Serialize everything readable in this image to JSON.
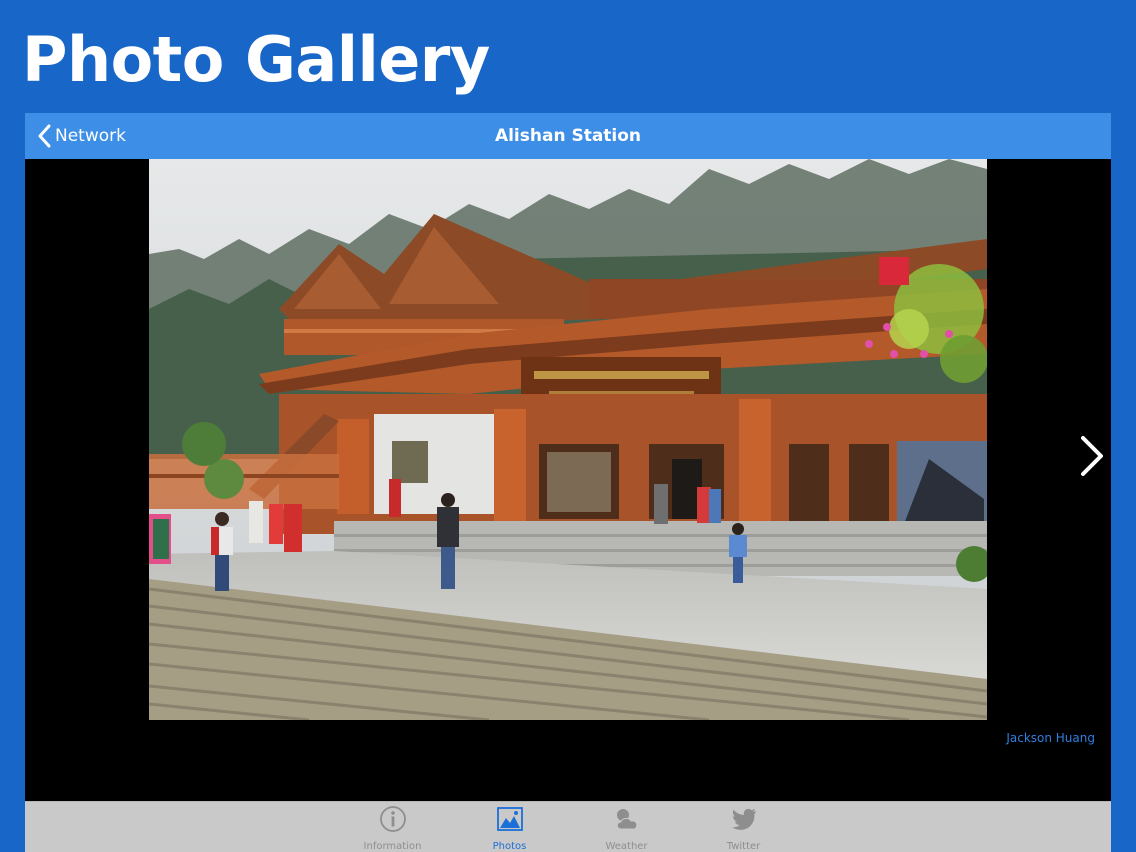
{
  "page": {
    "title": "Photo Gallery"
  },
  "navbar": {
    "back_label": "Network",
    "title": "Alishan Station"
  },
  "photo": {
    "credit": "Jackson Huang"
  },
  "tabs": [
    {
      "label": "Information",
      "icon": "info-icon",
      "active": false
    },
    {
      "label": "Photos",
      "icon": "photo-icon",
      "active": true
    },
    {
      "label": "Weather",
      "icon": "weather-icon",
      "active": false
    },
    {
      "label": "Twitter",
      "icon": "twitter-icon",
      "active": false
    }
  ],
  "colors": {
    "background": "#1866c8",
    "navbar": "#3d8ee6",
    "active_tab": "#1b6fd9",
    "inactive_tab": "#8e8e8e"
  }
}
